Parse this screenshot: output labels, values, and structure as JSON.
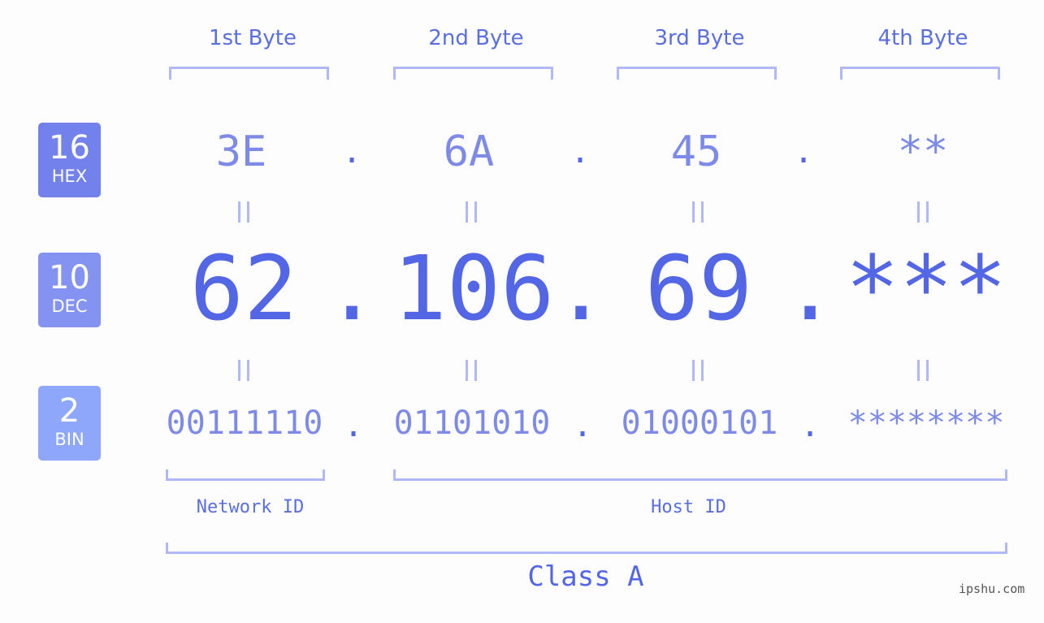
{
  "badges": [
    {
      "base": "16",
      "label": "HEX",
      "color": "#7281eb"
    },
    {
      "base": "10",
      "label": "DEC",
      "color": "#8493f2"
    },
    {
      "base": "2",
      "label": "BIN",
      "color": "#8fa7fb"
    }
  ],
  "bytes": [
    {
      "header": "1st Byte",
      "hex": "3E",
      "dec": "62",
      "bin": "00111110"
    },
    {
      "header": "2nd Byte",
      "hex": "6A",
      "dec": "106",
      "bin": "01101010"
    },
    {
      "header": "3rd Byte",
      "hex": "45",
      "dec": "69",
      "bin": "01000101"
    },
    {
      "header": "4th Byte",
      "hex": "**",
      "dec": "***",
      "bin": "********"
    }
  ],
  "separator": ".",
  "network_label": "Network ID",
  "host_label": "Host ID",
  "class_label": "Class A",
  "watermark": "ipshu.com"
}
